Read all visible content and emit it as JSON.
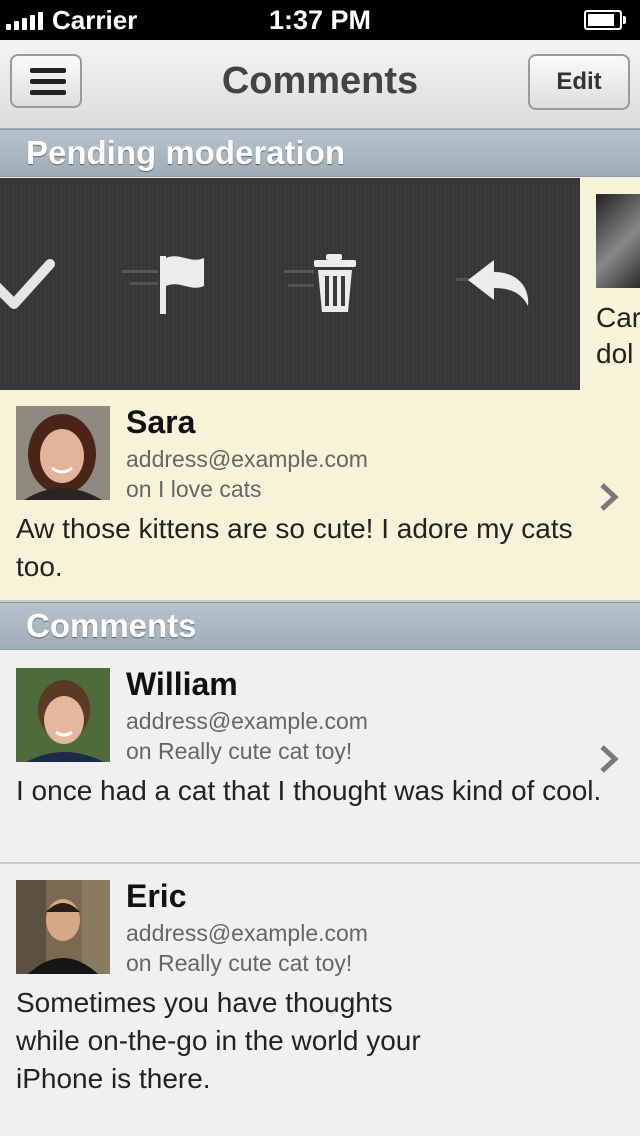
{
  "status_bar": {
    "carrier": "Carrier",
    "time": "1:37 PM"
  },
  "nav": {
    "title": "Comments",
    "edit_label": "Edit",
    "menu_icon": "hamburger-menu-icon"
  },
  "pending_section": {
    "title": "Pending moderation"
  },
  "actions": [
    "approve-check-icon",
    "flag-icon",
    "trash-icon",
    "reply-icon"
  ],
  "peek_row": {
    "text_line1": "Car",
    "text_line2": "dol"
  },
  "pending_comments": [
    {
      "name": "Sara",
      "email": "address@example.com",
      "post": "on I love cats",
      "body": "Aw those kittens are so cute! I adore my cats too."
    }
  ],
  "comments_section": {
    "title": "Comments"
  },
  "comments": [
    {
      "name": "William",
      "email": "address@example.com",
      "post": "on Really cute cat toy!",
      "body": "I once had a cat that I thought was kind of cool."
    },
    {
      "name": "Eric",
      "email": "address@example.com",
      "post": "on Really cute cat toy!",
      "body": "Sometimes you have thoughts while on-the-go in the world your iPhone is there."
    }
  ],
  "colors": {
    "pending_bg": "#f6f3d8",
    "section_header": "#a9b7c1",
    "action_bar": "#383838"
  }
}
